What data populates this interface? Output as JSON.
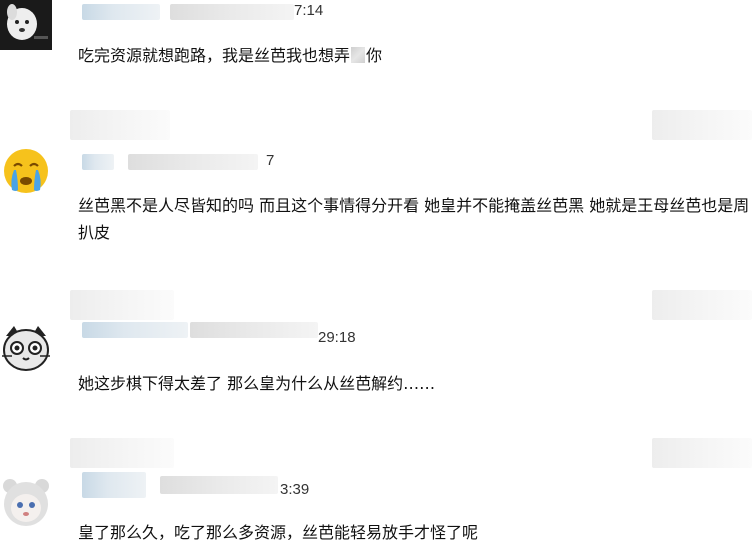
{
  "comments": [
    {
      "time": "7:14",
      "text_before": "吃完资源就想跑路，我是丝芭我也想弄",
      "text_after": "你",
      "avatar": "dog-avatar"
    },
    {
      "time": "7",
      "text": "丝芭黑不是人尽皆知的吗 而且这个事情得分开看 她皇并不能掩盖丝芭黑 她就是王母丝芭也是周扒皮",
      "avatar": "crying-emoji-avatar"
    },
    {
      "time": "29:18",
      "text": "她这步棋下得太差了 那么皇为什么从丝芭解约……",
      "avatar": "cat-avatar"
    },
    {
      "time": "3:39",
      "text": "皇了那么久，吃了那么多资源，丝芭能轻易放手才怪了呢",
      "avatar": "bear-hood-avatar"
    }
  ],
  "colors": {
    "emoji_yellow": "#f6c21c",
    "tear_blue": "#4aa3e6",
    "bg": "#ffffff"
  }
}
